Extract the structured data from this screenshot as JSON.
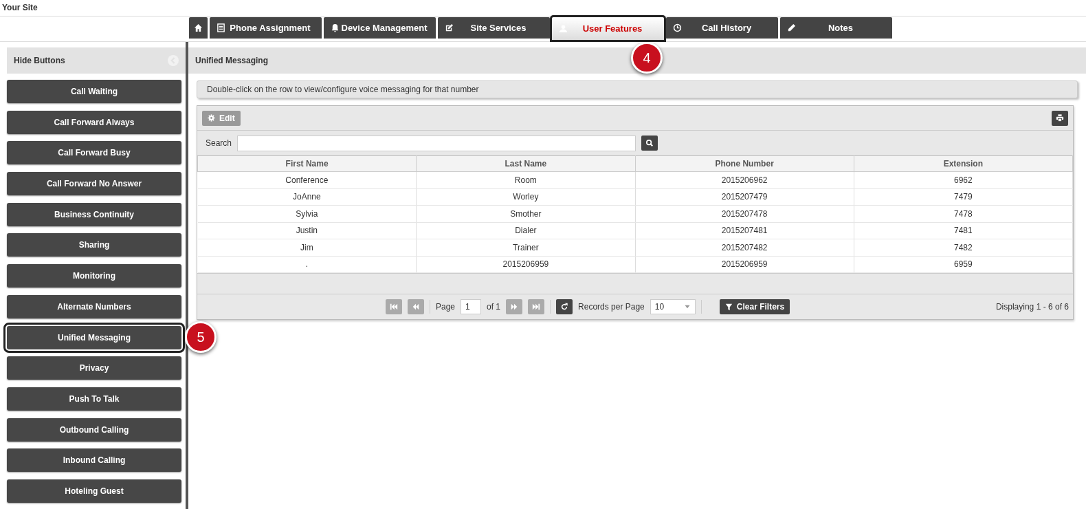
{
  "site_title": "Your Site",
  "tabs": [
    {
      "kind": "home",
      "selected": false
    },
    {
      "label": "Phone Assignment",
      "kind": "list",
      "selected": false
    },
    {
      "label": "Device Management",
      "kind": "bell",
      "selected": false
    },
    {
      "label": "Site Services",
      "kind": "edit",
      "selected": false
    },
    {
      "label": "User Features",
      "kind": "user",
      "selected": true,
      "callout": "4"
    },
    {
      "label": "Call History",
      "kind": "clock",
      "selected": false
    },
    {
      "label": "Notes",
      "kind": "pencil",
      "selected": false
    }
  ],
  "sidebar": {
    "title": "Hide Buttons",
    "items": [
      {
        "label": "Call Waiting",
        "selected": false
      },
      {
        "label": "Call Forward Always",
        "selected": false
      },
      {
        "label": "Call Forward Busy",
        "selected": false
      },
      {
        "label": "Call Forward No Answer",
        "selected": false
      },
      {
        "label": "Business Continuity",
        "selected": false
      },
      {
        "label": "Sharing",
        "selected": false
      },
      {
        "label": "Monitoring",
        "selected": false
      },
      {
        "label": "Alternate Numbers",
        "selected": false
      },
      {
        "label": "Unified Messaging",
        "selected": true,
        "callout": "5"
      },
      {
        "label": "Privacy",
        "selected": false
      },
      {
        "label": "Push To Talk",
        "selected": false
      },
      {
        "label": "Outbound Calling",
        "selected": false
      },
      {
        "label": "Inbound Calling",
        "selected": false
      },
      {
        "label": "Hoteling Guest",
        "selected": false
      }
    ]
  },
  "panel": {
    "title": "Unified Messaging",
    "hint": "Double-click on the row to view/configure voice messaging for that number",
    "edit_button": {
      "label": "Edit",
      "disabled": true
    },
    "search": {
      "label": "Search"
    },
    "table": {
      "columns": [
        "First Name",
        "Last Name",
        "Phone Number",
        "Extension"
      ],
      "rows": [
        [
          "Conference",
          "Room",
          "2015206962",
          "6962"
        ],
        [
          "JoAnne",
          "Worley",
          "2015207479",
          "7479"
        ],
        [
          "Sylvia",
          "Smother",
          "2015207478",
          "7478"
        ],
        [
          "Justin",
          "Dialer",
          "2015207481",
          "7481"
        ],
        [
          "Jim",
          "Trainer",
          "2015207482",
          "7482"
        ],
        [
          ".",
          "2015206959",
          "2015206959",
          "6959"
        ]
      ]
    },
    "pager": {
      "page_label": "Page",
      "page": "1",
      "of": "of 1",
      "per_page_label": "Records per Page",
      "per_page": "10",
      "clear_filters": "Clear Filters",
      "displaying": "Displaying 1 - 6 of 6"
    }
  }
}
